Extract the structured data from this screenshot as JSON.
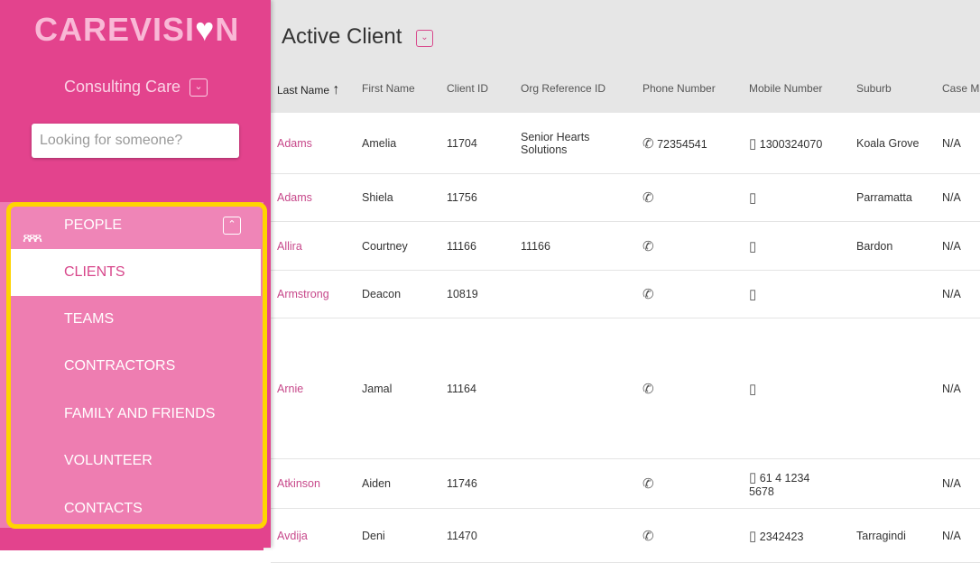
{
  "sidebar": {
    "logo": "CAREVISI",
    "logo_end": "N",
    "org": "Consulting Care",
    "search_placeholder": "Looking for someone?",
    "section": "PEOPLE",
    "items": [
      "CLIENTS",
      "TEAMS",
      "CONTRACTORS",
      "FAMILY AND FRIENDS",
      "VOLUNTEER",
      "CONTACTS"
    ],
    "active": "CLIENTS"
  },
  "main": {
    "title": "Active Client",
    "columns": [
      "Last Name",
      "First Name",
      "Client ID",
      "Org Reference ID",
      "Phone Number",
      "Mobile Number",
      "Suburb",
      "Case Ma"
    ],
    "rows": [
      {
        "last": "Adams",
        "first": "Amelia",
        "id": "11704",
        "org": "Senior Hearts Solutions",
        "phone": "72354541",
        "mobile": "1300324070",
        "suburb": "Koala Grove",
        "case": "N/A"
      },
      {
        "last": "Adams",
        "first": "Shiela",
        "id": "11756",
        "org": "",
        "phone": "",
        "mobile": "",
        "suburb": "Parramatta",
        "case": "N/A"
      },
      {
        "last": "Allira",
        "first": "Courtney",
        "id": "11166",
        "org": "11166",
        "phone": "",
        "mobile": "",
        "suburb": "Bardon",
        "case": "N/A"
      },
      {
        "last": "Armstrong",
        "first": "Deacon",
        "id": "10819",
        "org": "",
        "phone": "",
        "mobile": "",
        "suburb": "",
        "case": "N/A"
      },
      {
        "last": "Arnie",
        "first": "Jamal",
        "id": "11164",
        "org": "",
        "phone": "",
        "mobile": "",
        "suburb": "",
        "case": "N/A"
      },
      {
        "last": "Atkinson",
        "first": "Aiden",
        "id": "11746",
        "org": "",
        "phone": "",
        "mobile": "61 4 1234 5678",
        "suburb": "",
        "case": "N/A"
      },
      {
        "last": "Avdija",
        "first": "Deni",
        "id": "11470",
        "org": "",
        "phone": "",
        "mobile": "2342423",
        "suburb": "Tarragindi",
        "case": "N/A"
      }
    ]
  }
}
